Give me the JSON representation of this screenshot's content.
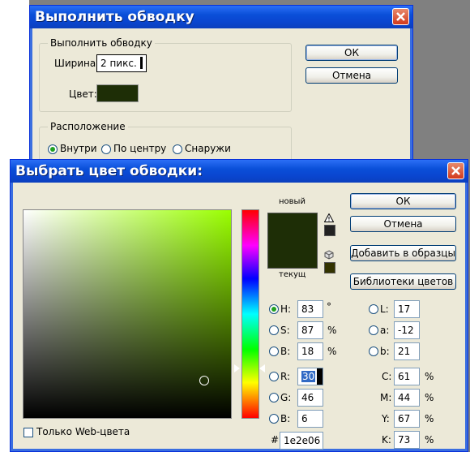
{
  "stroke_dialog": {
    "title": "Выполнить обводку",
    "group_stroke": "Выполнить обводку",
    "width_label": "Ширина:",
    "width_value": "2 пикс.",
    "color_label": "Цвет:",
    "color_swatch": "#1e2e06",
    "group_location": "Расположение",
    "location_options": [
      "Внутри",
      "По центру",
      "Снаружи"
    ],
    "location_selected": "Внутри",
    "ok_label": "ОК",
    "cancel_label": "Отмена"
  },
  "picker": {
    "title": "Выбрать цвет обводки:",
    "new_label": "новый",
    "current_label": "текущ",
    "new_color": "#1e2e06",
    "current_color": "#1e2e06",
    "hue_color": "#9aff00",
    "ok_label": "ОК",
    "cancel_label": "Отмена",
    "add_swatch_label": "Добавить в образцы",
    "libraries_label": "Библиотеки цветов",
    "web_only_label": "Только Web-цвета",
    "fields": {
      "H": {
        "label": "H:",
        "value": "83",
        "unit": "°"
      },
      "S": {
        "label": "S:",
        "value": "87",
        "unit": "%"
      },
      "Bri": {
        "label": "B:",
        "value": "18",
        "unit": "%"
      },
      "R": {
        "label": "R:",
        "value": "30"
      },
      "G": {
        "label": "G:",
        "value": "46"
      },
      "Blue": {
        "label": "B:",
        "value": "6"
      },
      "L": {
        "label": "L:",
        "value": "17"
      },
      "a": {
        "label": "a:",
        "value": "-12"
      },
      "b": {
        "label": "b:",
        "value": "21"
      },
      "C": {
        "label": "C:",
        "value": "61",
        "unit": "%"
      },
      "M": {
        "label": "M:",
        "value": "44",
        "unit": "%"
      },
      "Y": {
        "label": "Y:",
        "value": "67",
        "unit": "%"
      },
      "K": {
        "label": "K:",
        "value": "73",
        "unit": "%"
      }
    },
    "hex_label": "#",
    "hex_value": "1e2e06"
  }
}
